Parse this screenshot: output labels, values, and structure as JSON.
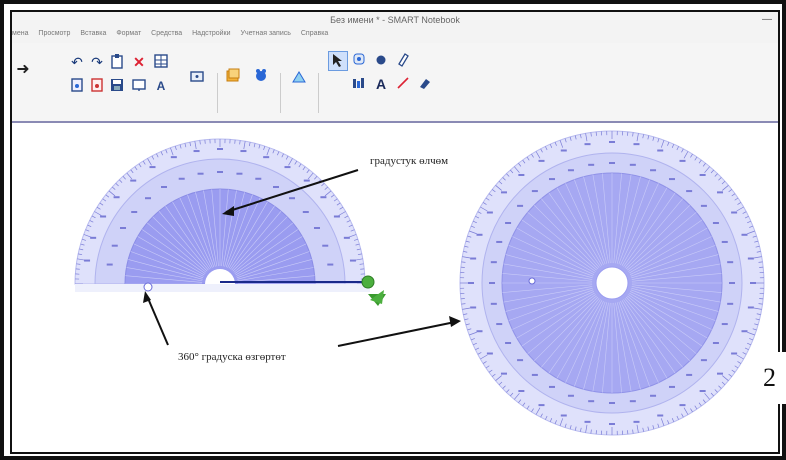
{
  "window": {
    "title": "Без имени * - SMART Notebook",
    "minimize_glyph": "—"
  },
  "menu": {
    "items": [
      "мена",
      "Просмотр",
      "Вставка",
      "Формат",
      "Средства",
      "Надстройки",
      "Учетная запись",
      "Справка"
    ]
  },
  "toolbar": {
    "icons": [
      "arrow-right-icon",
      "undo-icon",
      "redo-icon",
      "clipboard-icon",
      "delete-icon",
      "table-icon",
      "new-page-icon",
      "pdf-icon",
      "save-icon",
      "screen-icon",
      "spell-icon",
      "display-icon",
      "gallery-icon",
      "addons-icon",
      "measure-icon",
      "select-icon",
      "pen-icon",
      "fill-icon",
      "eraser-icon",
      "magic-pen-icon",
      "text-icon",
      "line-icon",
      "shape-icon"
    ],
    "accent": "#2a67d6"
  },
  "annotations": {
    "label_1": "градустук өлчөм",
    "label_2": "360° градуска өзгөртөт"
  },
  "page_number": "2",
  "colors": {
    "protractor_fill": "#9a9cf0",
    "protractor_light": "#dfe1fb",
    "handle_green": "#4caf3e",
    "border": "#111111"
  }
}
